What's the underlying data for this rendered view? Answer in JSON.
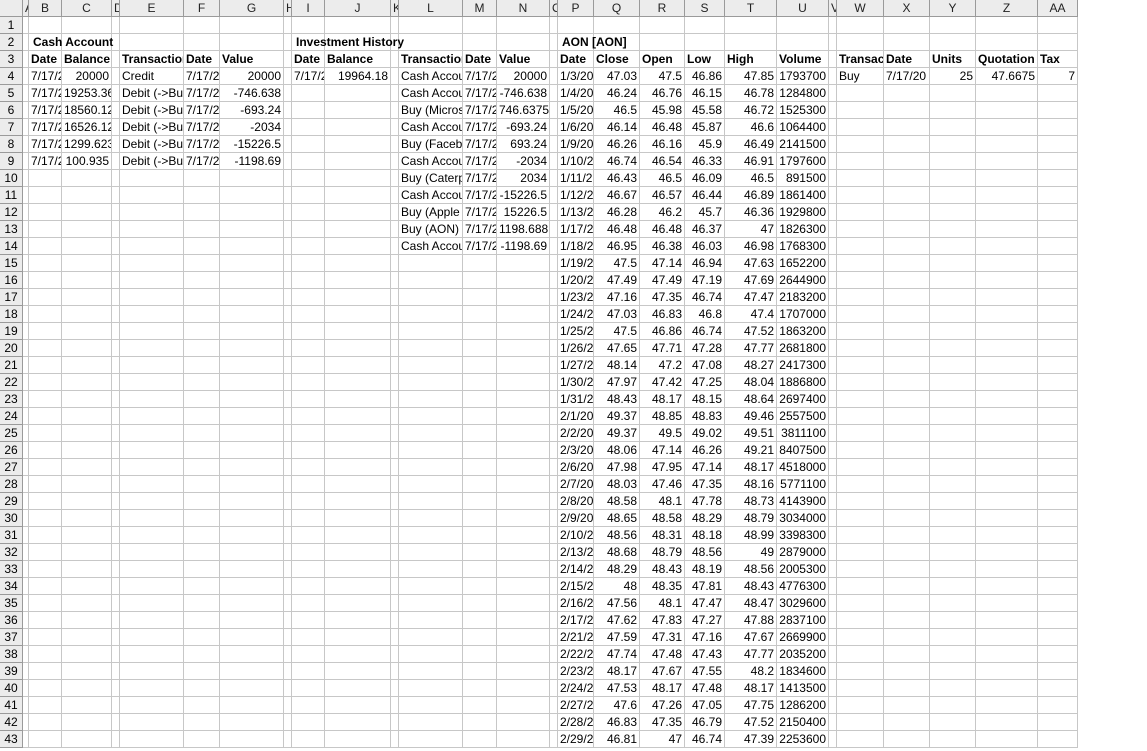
{
  "columns": [
    "A",
    "B",
    "C",
    "D",
    "E",
    "F",
    "G",
    "H",
    "I",
    "J",
    "K",
    "L",
    "M",
    "N",
    "O",
    "P",
    "Q",
    "R",
    "S",
    "T",
    "U",
    "V",
    "W",
    "X",
    "Y",
    "Z",
    "AA"
  ],
  "rows": [
    {
      "n": "1",
      "cells": {}
    },
    {
      "n": "2",
      "cells": {
        "B": "Cash Account",
        "I": "Investment History",
        "P": "AON [AON]"
      }
    },
    {
      "n": "3",
      "cells": {
        "B": "Date",
        "C": "Balance",
        "E": "Transaction",
        "F": "Date",
        "G": "Value",
        "I": "Date",
        "J": "Balance",
        "L": "Transaction",
        "M": "Date",
        "N": "Value",
        "P": "Date",
        "Q": "Close",
        "R": "Open",
        "S": "Low",
        "T": "High",
        "U": "Volume",
        "W": "Transaction",
        "X": "Date",
        "Y": "Units",
        "Z": "Quotation",
        "AA": "Tax"
      }
    },
    {
      "n": "4",
      "cells": {
        "B": "7/17/2",
        "C": "20000",
        "E": "Credit",
        "F": "7/17/2",
        "G": "20000",
        "I": "7/17/2",
        "J": "19964.18",
        "L": "Cash Account",
        "M": "7/17/2",
        "N": "20000",
        "P": "1/3/20",
        "Q": "47.03",
        "R": "47.5",
        "S": "46.86",
        "T": "47.85",
        "U": "1793700",
        "W": "Buy",
        "X": "7/17/20",
        "Y": "25",
        "Z": "47.6675",
        "AA": "7"
      }
    },
    {
      "n": "5",
      "cells": {
        "B": "7/17/2",
        "C": "19253.36",
        "E": "Debit (->Buy",
        "F": "7/17/2",
        "G": "-746.638",
        "L": "Cash Account",
        "M": "7/17/2",
        "N": "-746.638",
        "P": "1/4/20",
        "Q": "46.24",
        "R": "46.76",
        "S": "46.15",
        "T": "46.78",
        "U": "1284800"
      }
    },
    {
      "n": "6",
      "cells": {
        "B": "7/17/2",
        "C": "18560.12",
        "E": "Debit (->Buy",
        "F": "7/17/2",
        "G": "-693.24",
        "L": "Buy (Microsoft",
        "M": "7/17/2",
        "N": "746.6375",
        "P": "1/5/20",
        "Q": "46.5",
        "R": "45.98",
        "S": "45.58",
        "T": "46.72",
        "U": "1525300"
      }
    },
    {
      "n": "7",
      "cells": {
        "B": "7/17/2",
        "C": "16526.12",
        "E": "Debit (->Buy",
        "F": "7/17/2",
        "G": "-2034",
        "L": "Cash Account",
        "M": "7/17/2",
        "N": "-693.24",
        "P": "1/6/20",
        "Q": "46.14",
        "R": "46.48",
        "S": "45.87",
        "T": "46.6",
        "U": "1064400"
      }
    },
    {
      "n": "8",
      "cells": {
        "B": "7/17/2",
        "C": "1299.623",
        "E": "Debit (->Buy",
        "F": "7/17/2",
        "G": "-15226.5",
        "L": "Buy (Facebook",
        "M": "7/17/2",
        "N": "693.24",
        "P": "1/9/20",
        "Q": "46.26",
        "R": "46.16",
        "S": "45.9",
        "T": "46.49",
        "U": "2141500"
      }
    },
    {
      "n": "9",
      "cells": {
        "B": "7/17/2",
        "C": "100.935",
        "E": "Debit (->Buy",
        "F": "7/17/2",
        "G": "-1198.69",
        "L": "Cash Account",
        "M": "7/17/2",
        "N": "-2034",
        "P": "1/10/2",
        "Q": "46.74",
        "R": "46.54",
        "S": "46.33",
        "T": "46.91",
        "U": "1797600"
      }
    },
    {
      "n": "10",
      "cells": {
        "L": "Buy (Caterpillar",
        "M": "7/17/2",
        "N": "2034",
        "P": "1/11/2",
        "Q": "46.43",
        "R": "46.5",
        "S": "46.09",
        "T": "46.5",
        "U": "891500"
      }
    },
    {
      "n": "11",
      "cells": {
        "L": "Cash Account",
        "M": "7/17/2",
        "N": "-15226.5",
        "P": "1/12/2",
        "Q": "46.67",
        "R": "46.57",
        "S": "46.44",
        "T": "46.89",
        "U": "1861400"
      }
    },
    {
      "n": "12",
      "cells": {
        "L": "Buy (Apple",
        "M": "7/17/2",
        "N": "15226.5",
        "P": "1/13/2",
        "Q": "46.28",
        "R": "46.2",
        "S": "45.7",
        "T": "46.36",
        "U": "1929800"
      }
    },
    {
      "n": "13",
      "cells": {
        "L": "Buy (AON)",
        "M": "7/17/2",
        "N": "1198.688",
        "P": "1/17/2",
        "Q": "46.48",
        "R": "46.48",
        "S": "46.37",
        "T": "47",
        "U": "1826300"
      }
    },
    {
      "n": "14",
      "cells": {
        "L": "Cash Account",
        "M": "7/17/2",
        "N": "-1198.69",
        "P": "1/18/2",
        "Q": "46.95",
        "R": "46.38",
        "S": "46.03",
        "T": "46.98",
        "U": "1768300"
      }
    },
    {
      "n": "15",
      "cells": {
        "P": "1/19/2",
        "Q": "47.5",
        "R": "47.14",
        "S": "46.94",
        "T": "47.63",
        "U": "1652200"
      }
    },
    {
      "n": "16",
      "cells": {
        "P": "1/20/2",
        "Q": "47.49",
        "R": "47.49",
        "S": "47.19",
        "T": "47.69",
        "U": "2644900"
      }
    },
    {
      "n": "17",
      "cells": {
        "P": "1/23/2",
        "Q": "47.16",
        "R": "47.35",
        "S": "46.74",
        "T": "47.47",
        "U": "2183200"
      }
    },
    {
      "n": "18",
      "cells": {
        "P": "1/24/2",
        "Q": "47.03",
        "R": "46.83",
        "S": "46.8",
        "T": "47.4",
        "U": "1707000"
      }
    },
    {
      "n": "19",
      "cells": {
        "P": "1/25/2",
        "Q": "47.5",
        "R": "46.86",
        "S": "46.74",
        "T": "47.52",
        "U": "1863200"
      }
    },
    {
      "n": "20",
      "cells": {
        "P": "1/26/2",
        "Q": "47.65",
        "R": "47.71",
        "S": "47.28",
        "T": "47.77",
        "U": "2681800"
      }
    },
    {
      "n": "21",
      "cells": {
        "P": "1/27/2",
        "Q": "48.14",
        "R": "47.2",
        "S": "47.08",
        "T": "48.27",
        "U": "2417300"
      }
    },
    {
      "n": "22",
      "cells": {
        "P": "1/30/2",
        "Q": "47.97",
        "R": "47.42",
        "S": "47.25",
        "T": "48.04",
        "U": "1886800"
      }
    },
    {
      "n": "23",
      "cells": {
        "P": "1/31/2",
        "Q": "48.43",
        "R": "48.17",
        "S": "48.15",
        "T": "48.64",
        "U": "2697400"
      }
    },
    {
      "n": "24",
      "cells": {
        "P": "2/1/20",
        "Q": "49.37",
        "R": "48.85",
        "S": "48.83",
        "T": "49.46",
        "U": "2557500"
      }
    },
    {
      "n": "25",
      "cells": {
        "P": "2/2/20",
        "Q": "49.37",
        "R": "49.5",
        "S": "49.02",
        "T": "49.51",
        "U": "3811100"
      }
    },
    {
      "n": "26",
      "cells": {
        "P": "2/3/20",
        "Q": "48.06",
        "R": "47.14",
        "S": "46.26",
        "T": "49.21",
        "U": "8407500"
      }
    },
    {
      "n": "27",
      "cells": {
        "P": "2/6/20",
        "Q": "47.98",
        "R": "47.95",
        "S": "47.14",
        "T": "48.17",
        "U": "4518000"
      }
    },
    {
      "n": "28",
      "cells": {
        "P": "2/7/20",
        "Q": "48.03",
        "R": "47.46",
        "S": "47.35",
        "T": "48.16",
        "U": "5771100"
      }
    },
    {
      "n": "29",
      "cells": {
        "P": "2/8/20",
        "Q": "48.58",
        "R": "48.1",
        "S": "47.78",
        "T": "48.73",
        "U": "4143900"
      }
    },
    {
      "n": "30",
      "cells": {
        "P": "2/9/20",
        "Q": "48.65",
        "R": "48.58",
        "S": "48.29",
        "T": "48.79",
        "U": "3034000"
      }
    },
    {
      "n": "31",
      "cells": {
        "P": "2/10/2",
        "Q": "48.56",
        "R": "48.31",
        "S": "48.18",
        "T": "48.99",
        "U": "3398300"
      }
    },
    {
      "n": "32",
      "cells": {
        "P": "2/13/2",
        "Q": "48.68",
        "R": "48.79",
        "S": "48.56",
        "T": "49",
        "U": "2879000"
      }
    },
    {
      "n": "33",
      "cells": {
        "P": "2/14/2",
        "Q": "48.29",
        "R": "48.43",
        "S": "48.19",
        "T": "48.56",
        "U": "2005300"
      }
    },
    {
      "n": "34",
      "cells": {
        "P": "2/15/2",
        "Q": "48",
        "R": "48.35",
        "S": "47.81",
        "T": "48.43",
        "U": "4776300"
      }
    },
    {
      "n": "35",
      "cells": {
        "P": "2/16/2",
        "Q": "47.56",
        "R": "48.1",
        "S": "47.47",
        "T": "48.47",
        "U": "3029600"
      }
    },
    {
      "n": "36",
      "cells": {
        "P": "2/17/2",
        "Q": "47.62",
        "R": "47.83",
        "S": "47.27",
        "T": "47.88",
        "U": "2837100"
      }
    },
    {
      "n": "37",
      "cells": {
        "P": "2/21/2",
        "Q": "47.59",
        "R": "47.31",
        "S": "47.16",
        "T": "47.67",
        "U": "2669900"
      }
    },
    {
      "n": "38",
      "cells": {
        "P": "2/22/2",
        "Q": "47.74",
        "R": "47.48",
        "S": "47.43",
        "T": "47.77",
        "U": "2035200"
      }
    },
    {
      "n": "39",
      "cells": {
        "P": "2/23/2",
        "Q": "48.17",
        "R": "47.67",
        "S": "47.55",
        "T": "48.2",
        "U": "1834600"
      }
    },
    {
      "n": "40",
      "cells": {
        "P": "2/24/2",
        "Q": "47.53",
        "R": "48.17",
        "S": "47.48",
        "T": "48.17",
        "U": "1413500"
      }
    },
    {
      "n": "41",
      "cells": {
        "P": "2/27/2",
        "Q": "47.6",
        "R": "47.26",
        "S": "47.05",
        "T": "47.75",
        "U": "1286200"
      }
    },
    {
      "n": "42",
      "cells": {
        "P": "2/28/2",
        "Q": "46.83",
        "R": "47.35",
        "S": "46.79",
        "T": "47.52",
        "U": "2150400"
      }
    },
    {
      "n": "43",
      "cells": {
        "P": "2/29/2",
        "Q": "46.81",
        "R": "47",
        "S": "46.74",
        "T": "47.39",
        "U": "2253600"
      }
    }
  ]
}
